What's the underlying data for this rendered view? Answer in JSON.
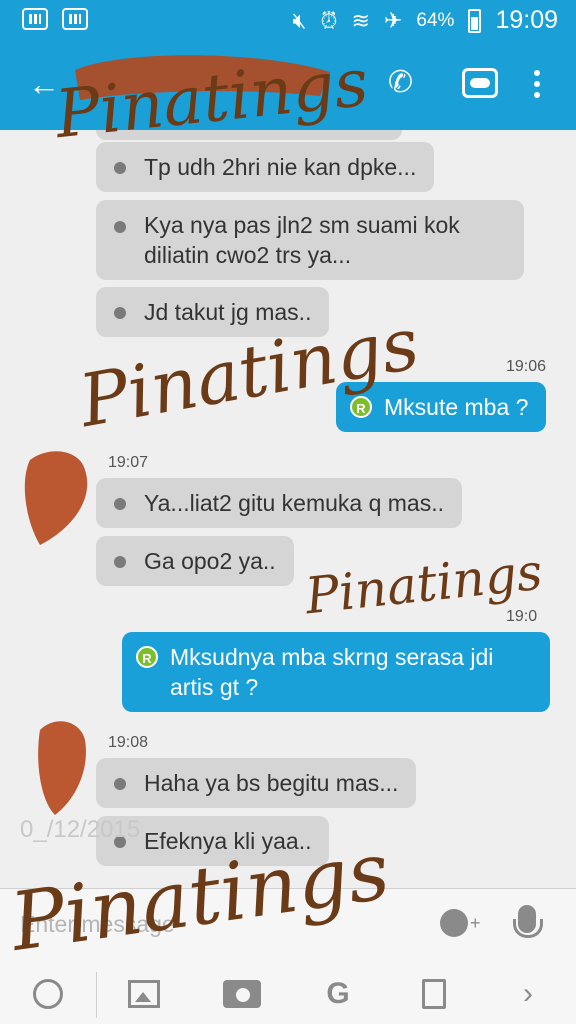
{
  "status_bar": {
    "battery": "64%",
    "time": "19:09",
    "icons": [
      "bbm-notification-icon",
      "bbm-notification-icon",
      "mute-icon",
      "alarm-icon",
      "wifi-icon",
      "airplane-icon",
      "battery-icon"
    ]
  },
  "app_bar": {
    "contact_name_redacted": true,
    "actions": [
      "back-arrow-icon",
      "phone-icon",
      "contact-card-icon",
      "overflow-menu-icon"
    ]
  },
  "messages": [
    {
      "dir": "in",
      "text": "Tp udh 2hri nie kan dpke..."
    },
    {
      "dir": "in",
      "text": "Kya nya pas jln2 sm suami kok diliatin cwo2 trs ya..."
    },
    {
      "dir": "in",
      "text": "Jd takut jg mas.."
    },
    {
      "dir": "out",
      "time": "19:06",
      "text": "Mksute mba ?",
      "badge": "R"
    },
    {
      "dir": "in",
      "time": "19:07",
      "text": "Ya...liat2 gitu kemuka q mas.."
    },
    {
      "dir": "in",
      "text": "Ga opo2 ya.."
    },
    {
      "dir": "out",
      "time": "19:0",
      "text": "Mksudnya mba skrng serasa jdi artis gt ?",
      "badge": "R"
    },
    {
      "dir": "in",
      "time": "19:08",
      "text": "Haha ya bs begitu mas..."
    },
    {
      "dir": "in",
      "text": "Efeknya kli yaa.."
    }
  ],
  "date_overlay": "0_/12/2015",
  "input": {
    "placeholder": "Enter message"
  },
  "toolbar_icons": [
    "timer-icon",
    "image-icon",
    "camera-icon",
    "glympse-icon",
    "file-icon",
    "chevron-right-icon"
  ],
  "watermark": "Pinatings"
}
